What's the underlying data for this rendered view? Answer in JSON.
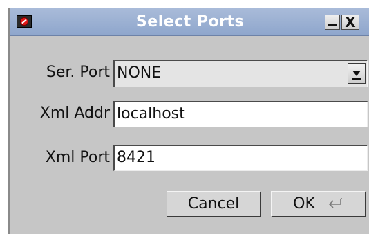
{
  "window": {
    "title": "Select Ports"
  },
  "titlebar_buttons": {
    "minimize_icon": "minimize-icon",
    "close_label": "X"
  },
  "form": {
    "serial_port": {
      "label": "Ser. Port",
      "value": "NONE"
    },
    "xml_addr": {
      "label": "Xml Addr",
      "value": "localhost"
    },
    "xml_port": {
      "label": "Xml Port",
      "value": "8421"
    }
  },
  "buttons": {
    "cancel_label": "Cancel",
    "ok_label": "OK",
    "ok_icon": "enter-key-icon"
  }
}
